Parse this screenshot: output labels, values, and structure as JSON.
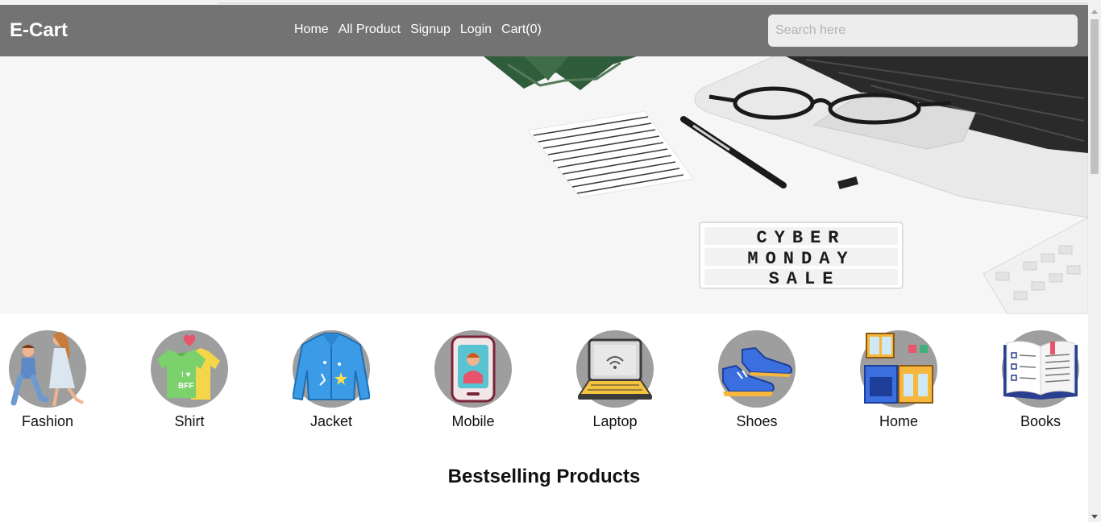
{
  "navbar": {
    "brand": "E-Cart",
    "links": [
      "Home",
      "All Product",
      "Signup",
      "Login",
      "Cart(0)"
    ],
    "search_placeholder": "Search here",
    "background": "#737373"
  },
  "hero": {
    "sign_lines": [
      "CYBER",
      "MONDAY",
      "SALE"
    ]
  },
  "categories": [
    {
      "label": "Fashion",
      "icon": "couple-proposal-icon"
    },
    {
      "label": "Shirt",
      "icon": "bff-shirts-icon"
    },
    {
      "label": "Jacket",
      "icon": "denim-jacket-icon"
    },
    {
      "label": "Mobile",
      "icon": "mobile-phone-icon"
    },
    {
      "label": "Laptop",
      "icon": "laptop-icon"
    },
    {
      "label": "Shoes",
      "icon": "sneakers-icon"
    },
    {
      "label": "Home",
      "icon": "kitchen-furniture-icon"
    },
    {
      "label": "Books",
      "icon": "open-book-icon"
    }
  ],
  "bestselling_title": "Bestselling Products"
}
